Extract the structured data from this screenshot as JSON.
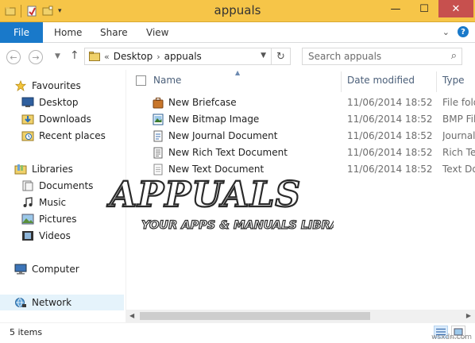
{
  "window": {
    "title": "appuals",
    "minimize_glyph": "—",
    "maximize_glyph": "☐",
    "close_glyph": "✕"
  },
  "ribbon": {
    "tabs": [
      "File",
      "Home",
      "Share",
      "View"
    ],
    "help_glyph": "?",
    "expand_glyph": "⌄"
  },
  "address_bar": {
    "overflow": "«",
    "path": [
      "Desktop",
      "appuals"
    ],
    "separator": "›"
  },
  "search": {
    "placeholder": "Search appuals"
  },
  "nav": {
    "favourites": {
      "label": "Favourites",
      "items": [
        "Desktop",
        "Downloads",
        "Recent places"
      ]
    },
    "libraries": {
      "label": "Libraries",
      "items": [
        "Documents",
        "Music",
        "Pictures",
        "Videos"
      ]
    },
    "computer": "Computer",
    "network": "Network"
  },
  "columns": {
    "name": "Name",
    "date_modified": "Date modified",
    "type": "Type"
  },
  "files": [
    {
      "name": "New Briefcase",
      "date": "11/06/2014 18:52",
      "type": "File folder",
      "icon": "briefcase-icon"
    },
    {
      "name": "New Bitmap Image",
      "date": "11/06/2014 18:52",
      "type": "BMP File",
      "icon": "bitmap-icon"
    },
    {
      "name": "New Journal Document",
      "date": "11/06/2014 18:52",
      "type": "Journal Document",
      "icon": "journal-icon"
    },
    {
      "name": "New Rich Text Document",
      "date": "11/06/2014 18:52",
      "type": "Rich Text Document",
      "icon": "rtf-icon"
    },
    {
      "name": "New Text Document",
      "date": "11/06/2014 18:52",
      "type": "Text Document",
      "icon": "text-file-icon"
    }
  ],
  "watermark": {
    "brand": "APPUALS",
    "tagline": "YOUR APPS & MANUALS LIBRARY"
  },
  "status": {
    "item_count": "5 items"
  },
  "site_mark": "wsxdn.com",
  "colors": {
    "title_bar": "#f6c548",
    "file_tab": "#1979ca",
    "close_button": "#c7504e",
    "selection": "#e5f3fb",
    "column_header_text": "#4c607a"
  }
}
